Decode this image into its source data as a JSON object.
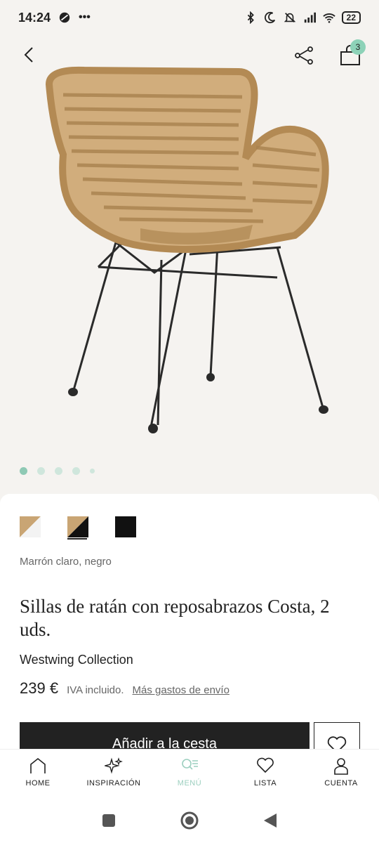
{
  "status_bar": {
    "time": "14:24",
    "battery": "22"
  },
  "header": {
    "cart_count": "3"
  },
  "gallery": {
    "image_count": 5,
    "active_index": 0
  },
  "product": {
    "color_label": "Marrón claro, negro",
    "title": "Sillas de ratán con reposabrazos Costa, 2 uds.",
    "brand": "Westwing Collection",
    "price": "239 €",
    "vat_note": "IVA incluido.",
    "shipping_link": "Más gastos de envío",
    "add_to_cart": "Añadir a la cesta"
  },
  "swatches": [
    {
      "name": "tan-white",
      "selected": false
    },
    {
      "name": "tan-black",
      "selected": true
    },
    {
      "name": "black",
      "selected": false
    }
  ],
  "bottom_nav": [
    {
      "label": "HOME",
      "icon": "home-icon"
    },
    {
      "label": "INSPIRACIÓN",
      "icon": "sparkle-icon"
    },
    {
      "label": "MENÚ",
      "icon": "menu-search-icon",
      "active": true
    },
    {
      "label": "LISTA",
      "icon": "heart-icon"
    },
    {
      "label": "CUENTA",
      "icon": "user-icon"
    }
  ],
  "colors": {
    "accent": "#8ec9b4",
    "rattan": "#c9a574",
    "frame": "#2a2a2a"
  }
}
